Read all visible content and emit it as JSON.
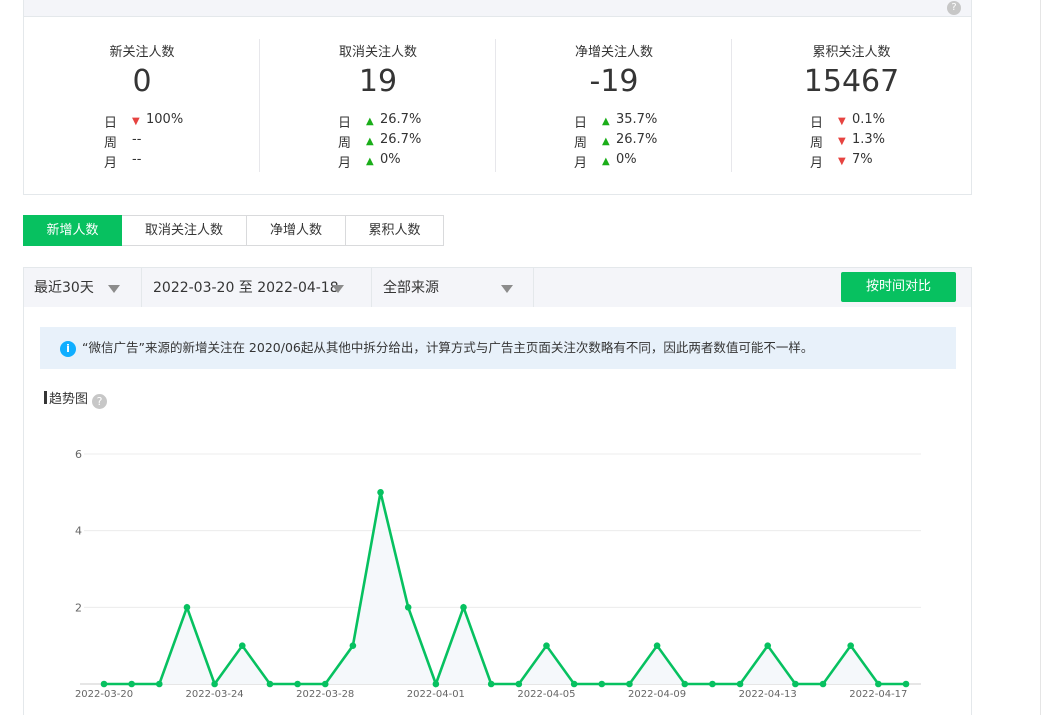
{
  "stats": [
    {
      "title": "新关注人数",
      "value": "0",
      "rows": [
        {
          "label": "日",
          "dir": "down",
          "value": "100%"
        },
        {
          "label": "周",
          "dir": "none",
          "value": "--"
        },
        {
          "label": "月",
          "dir": "none",
          "value": "--"
        }
      ]
    },
    {
      "title": "取消关注人数",
      "value": "19",
      "rows": [
        {
          "label": "日",
          "dir": "up",
          "value": "26.7%"
        },
        {
          "label": "周",
          "dir": "up",
          "value": "26.7%"
        },
        {
          "label": "月",
          "dir": "up",
          "value": "0%"
        }
      ]
    },
    {
      "title": "净增关注人数",
      "value": "-19",
      "rows": [
        {
          "label": "日",
          "dir": "up",
          "value": "35.7%"
        },
        {
          "label": "周",
          "dir": "up",
          "value": "26.7%"
        },
        {
          "label": "月",
          "dir": "up",
          "value": "0%"
        }
      ]
    },
    {
      "title": "累积关注人数",
      "value": "15467",
      "rows": [
        {
          "label": "日",
          "dir": "down",
          "value": "0.1%"
        },
        {
          "label": "周",
          "dir": "down",
          "value": "1.3%"
        },
        {
          "label": "月",
          "dir": "down",
          "value": "7%"
        }
      ]
    }
  ],
  "tabs": [
    "新增人数",
    "取消关注人数",
    "净增人数",
    "累积人数"
  ],
  "active_tab": 0,
  "filters": {
    "range": "最近30天",
    "dates": "2022-03-20 至 2022-04-18",
    "source": "全部来源",
    "compare_button": "按时间对比"
  },
  "notice": "“微信广告”来源的新增关注在 2020/06起从其他中拆分给出，计算方式与广告主页面关注次数略有不同，因此两者数值可能不一样。",
  "chart_title": "趋势图",
  "colors": {
    "accent": "#07c160",
    "up": "#1aad19",
    "down": "#e64340",
    "line": "#07c160",
    "area": "#f5f8fb"
  },
  "chart_data": {
    "type": "line",
    "title": "",
    "xlabel": "",
    "ylabel": "",
    "ylim": [
      0,
      6
    ],
    "yticks": [
      2,
      4,
      6
    ],
    "grid": true,
    "x": [
      "2022-03-20",
      "2022-03-21",
      "2022-03-22",
      "2022-03-23",
      "2022-03-24",
      "2022-03-25",
      "2022-03-26",
      "2022-03-27",
      "2022-03-28",
      "2022-03-29",
      "2022-03-30",
      "2022-03-31",
      "2022-04-01",
      "2022-04-02",
      "2022-04-03",
      "2022-04-04",
      "2022-04-05",
      "2022-04-06",
      "2022-04-07",
      "2022-04-08",
      "2022-04-09",
      "2022-04-10",
      "2022-04-11",
      "2022-04-12",
      "2022-04-13",
      "2022-04-14",
      "2022-04-15",
      "2022-04-16",
      "2022-04-17",
      "2022-04-18"
    ],
    "xtick_labels": [
      "2022-03-20",
      "2022-03-24",
      "2022-03-28",
      "2022-04-01",
      "2022-04-05",
      "2022-04-09",
      "2022-04-13",
      "2022-04-17"
    ],
    "series": [
      {
        "values": [
          0,
          0,
          0,
          2,
          0,
          1,
          0,
          0,
          0,
          1,
          5,
          2,
          0,
          2,
          0,
          0,
          1,
          0,
          0,
          0,
          1,
          0,
          0,
          0,
          1,
          0,
          0,
          1,
          0,
          0
        ]
      }
    ]
  }
}
